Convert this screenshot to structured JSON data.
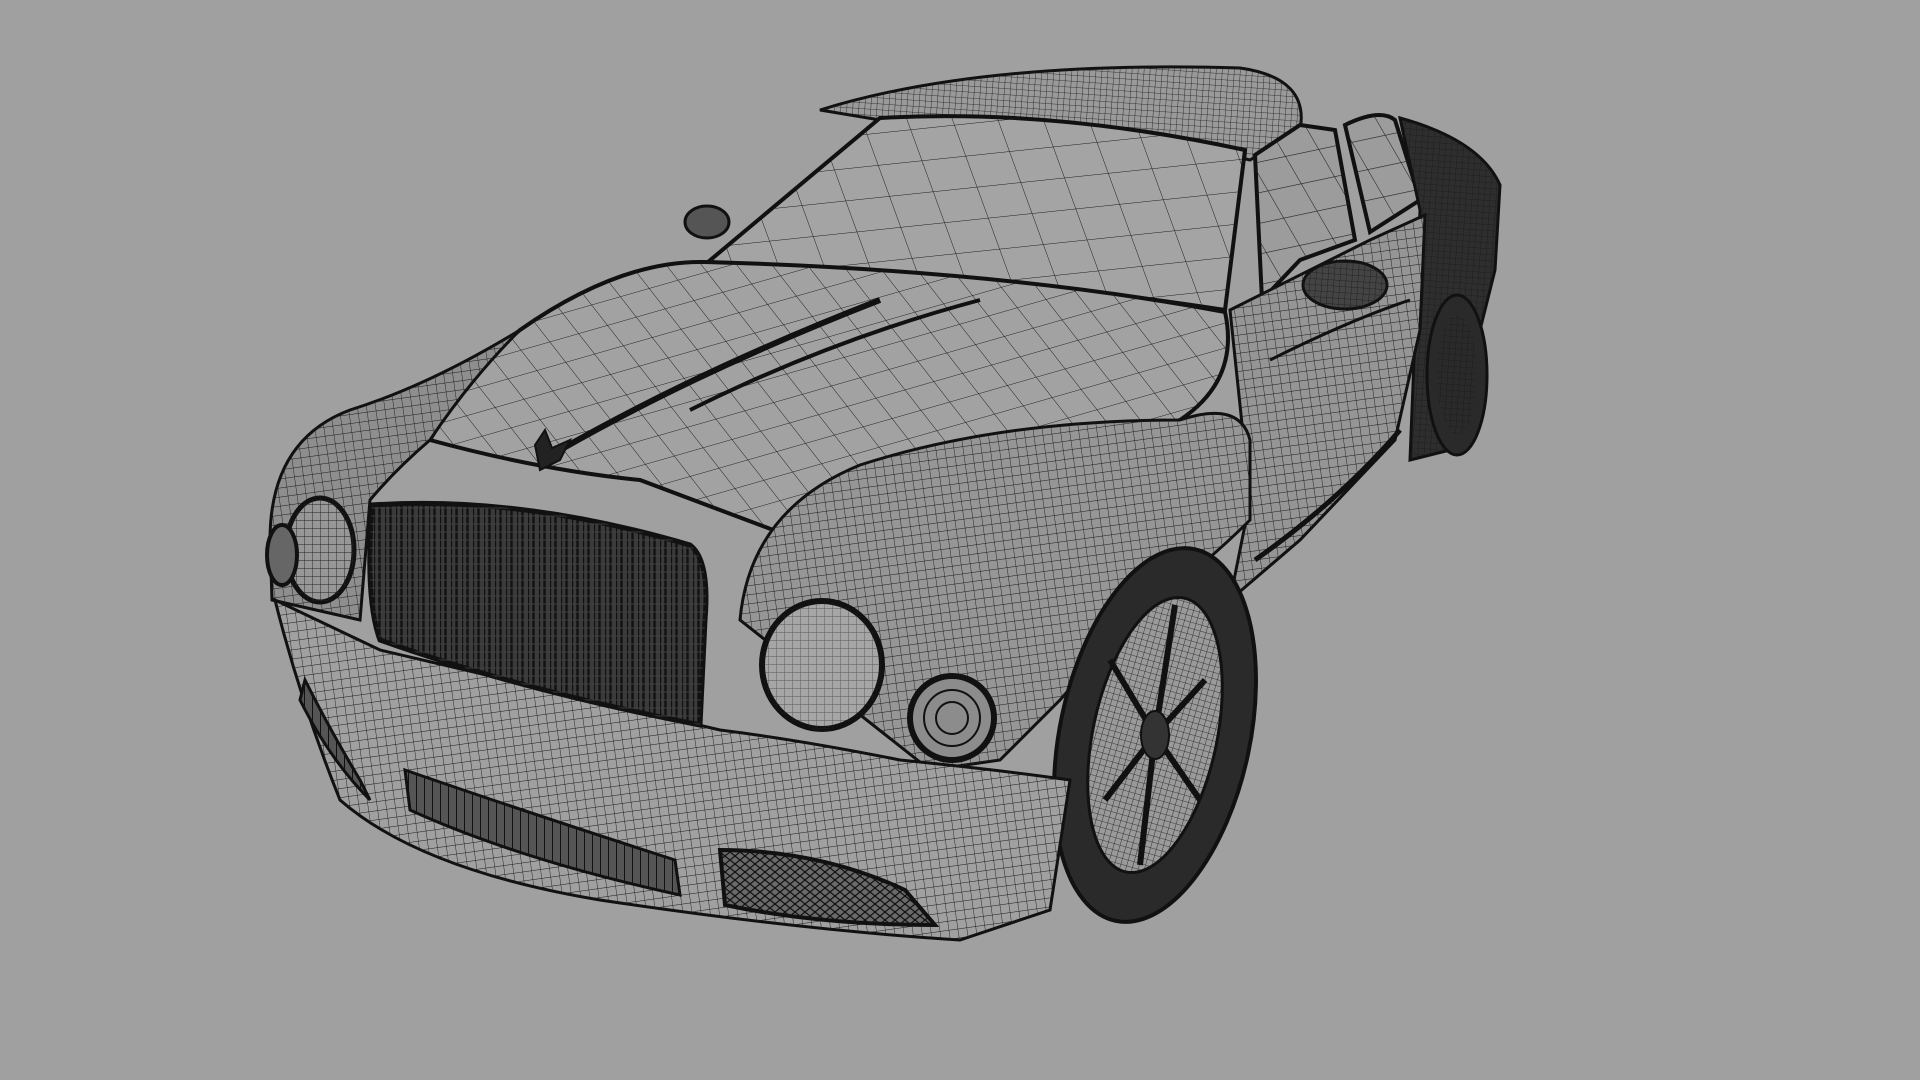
{
  "viewport": {
    "background_color": "#a0a0a0",
    "wire_color": "#1a1a1a",
    "shade_color": "#8a8a8a",
    "dark_fill_color": "#2b2b2b"
  },
  "model": {
    "subject": "car-wireframe-mesh"
  }
}
